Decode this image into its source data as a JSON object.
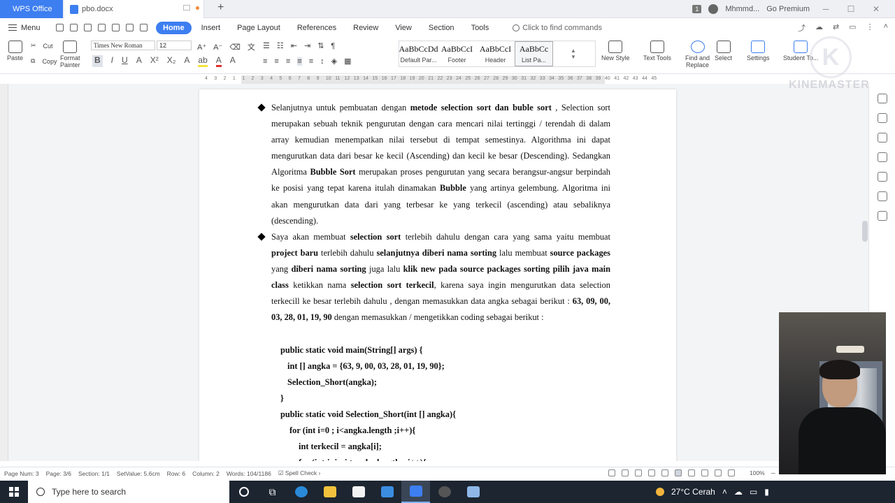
{
  "title_bar": {
    "app_tab": "WPS Office",
    "doc_tab": "pbo.docx",
    "notif_count": "1",
    "user_name": "Mhmmd...",
    "premium": "Go Premium"
  },
  "menu": {
    "menu_label": "Menu",
    "tabs": [
      "Home",
      "Insert",
      "Page Layout",
      "References",
      "Review",
      "View",
      "Section",
      "Tools"
    ],
    "active_tab": "Home",
    "command_search": "Click to find commands"
  },
  "ribbon": {
    "paste": "Paste",
    "cut": "Cut",
    "copy": "Copy",
    "format_painter_1": "Format",
    "format_painter_2": "Painter",
    "font_name": "Times New Roman",
    "font_size": "12",
    "styles": [
      {
        "sample": "AaBbCcDd",
        "label": "Default Par..."
      },
      {
        "sample": "AaBbCcI",
        "label": "Footer"
      },
      {
        "sample": "AaBbCcI",
        "label": "Header"
      },
      {
        "sample": "AaBbCc",
        "label": "List Pa..."
      }
    ],
    "new_style": "New Style",
    "text_tools": "Text Tools",
    "find_replace_1": "Find and",
    "find_replace_2": "Replace",
    "select": "Select",
    "settings": "Settings",
    "student_tools": "Student To..."
  },
  "ruler_numbers": [
    "4",
    "3",
    "2",
    "1",
    "1",
    "2",
    "3",
    "4",
    "5",
    "6",
    "7",
    "8",
    "9",
    "10",
    "11",
    "12",
    "13",
    "14",
    "15",
    "16",
    "17",
    "18",
    "19",
    "20",
    "21",
    "22",
    "23",
    "24",
    "25",
    "26",
    "27",
    "28",
    "29",
    "30",
    "31",
    "32",
    "33",
    "34",
    "35",
    "36",
    "37",
    "38",
    "39",
    "40",
    "41",
    "42",
    "43",
    "44",
    "45"
  ],
  "document": {
    "para1": [
      {
        "t": "Selanjutnya untuk pembuatan dengan ",
        "b": false
      },
      {
        "t": "metode selection sort dan buble sort",
        "b": true
      },
      {
        "t": " , Selection sort merupakan sebuah teknik pengurutan dengan cara mencari nilai tertinggi / terendah di dalam array kemudian menempatkan nilai tersebut di tempat semestinya. Algorithma ini dapat mengurutkan data dari besar ke kecil (Ascending) dan kecil ke besar (Descending). Sedangkan Algoritma ",
        "b": false
      },
      {
        "t": "Bubble Sort",
        "b": true
      },
      {
        "t": " merupakan proses pengurutan yang secara berangsur-angsur berpindah ke posisi yang tepat karena itulah dinamakan ",
        "b": false
      },
      {
        "t": "Bubble",
        "b": true
      },
      {
        "t": " yang artinya gelembung. Algoritma ini akan mengurutkan data dari yang terbesar ke yang terkecil (ascending) atau sebaliknya (descending).",
        "b": false
      }
    ],
    "para2": [
      {
        "t": "Saya akan membuat ",
        "b": false
      },
      {
        "t": "selection sort",
        "b": true
      },
      {
        "t": " terlebih dahulu dengan cara yang sama yaitu membuat ",
        "b": false
      },
      {
        "t": "project baru",
        "b": true
      },
      {
        "t": " terlebih dahulu ",
        "b": false
      },
      {
        "t": "selanjutnya diberi nama sorting",
        "b": true
      },
      {
        "t": " lalu membuat ",
        "b": false
      },
      {
        "t": "source packages",
        "b": true
      },
      {
        "t": " yang ",
        "b": false
      },
      {
        "t": "diberi nama sorting",
        "b": true
      },
      {
        "t": " juga lalu ",
        "b": false
      },
      {
        "t": "klik new pada source packages sorting pilih java main class",
        "b": true
      },
      {
        "t": " ketikkan nama ",
        "b": false
      },
      {
        "t": "selection sort terkecil",
        "b": true
      },
      {
        "t": ", karena saya ingin mengurutkan data selection terkecill ke besar terlebih dahulu , dengan memasukkan data angka sebagai berikut : ",
        "b": false
      },
      {
        "t": "63, 09, 00, 03, 28, 01, 19, 90",
        "b": true
      },
      {
        "t": " dengan memasukkan / mengetikkan coding sebagai berikut :",
        "b": false
      }
    ],
    "code": [
      "public static void main(String[] args) {",
      "int [] angka = {63, 9, 00, 03, 28, 01, 19, 90};",
      "Selection_Short(angka);",
      "}",
      "public static void Selection_Short(int [] angka){",
      "for (int i=0 ; i<angka.length ;i++){",
      "int terkecil = angka[i];",
      "for (int j=i ; j<angka.length ; j++){"
    ]
  },
  "status": {
    "page_num": "Page Num: 3",
    "page": "Page: 3/6",
    "section": "Section: 1/1",
    "set_value": "SetValue: 5.6cm",
    "row": "Row: 6",
    "column": "Column: 2",
    "words": "Words: 104/1186",
    "spell_check": "Spell Check",
    "zoom": "100%"
  },
  "taskbar": {
    "search_placeholder": "Type here to search",
    "weather": "27°C  Cerah"
  },
  "overlay": {
    "watermark": "KINEMASTER"
  },
  "colors": {
    "accent": "#3d7ef0",
    "taskbar": "#1c2530"
  }
}
